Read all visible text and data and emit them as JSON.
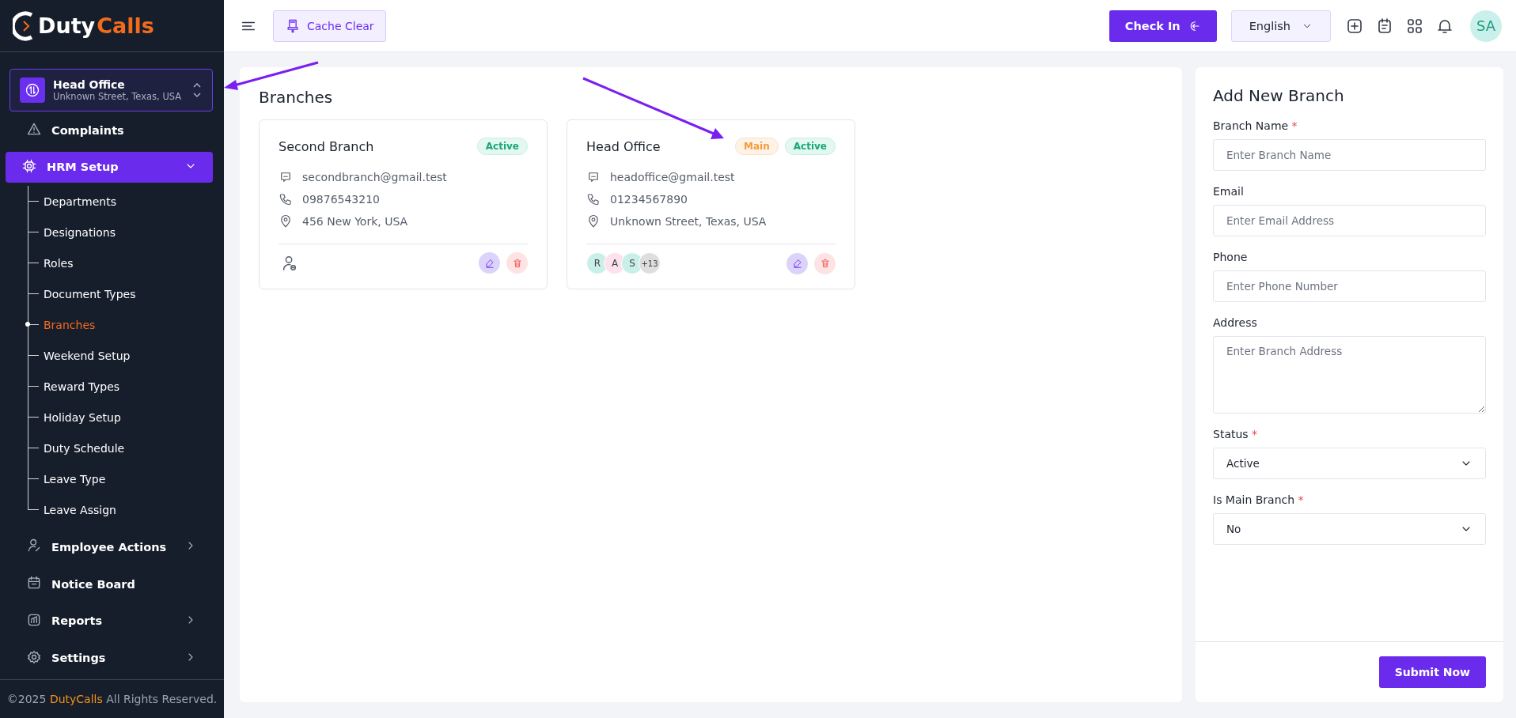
{
  "sidebar": {
    "logo": {
      "part_1": "Duty",
      "part_2": "Calls"
    },
    "branch_selector": {
      "name": "Head Office",
      "address": "Unknown Street, Texas, USA"
    },
    "menu": [
      {
        "label": "Complaints",
        "submenu": false,
        "expanded": false,
        "selected": false
      },
      {
        "label": "HRM Setup",
        "submenu": true,
        "expanded": true,
        "selected": true,
        "children": [
          {
            "label": "Departments",
            "selected": false
          },
          {
            "label": "Designations",
            "selected": false
          },
          {
            "label": "Roles",
            "selected": false
          },
          {
            "label": "Document Types",
            "selected": false
          },
          {
            "label": "Branches",
            "selected": true
          },
          {
            "label": "Weekend Setup",
            "selected": false
          },
          {
            "label": "Reward Types",
            "selected": false
          },
          {
            "label": "Holiday Setup",
            "selected": false
          },
          {
            "label": "Duty Schedule",
            "selected": false
          },
          {
            "label": "Leave Type",
            "selected": false
          },
          {
            "label": "Leave Assign",
            "selected": false
          }
        ]
      },
      {
        "label": "Employee Actions",
        "submenu": true,
        "expanded": false,
        "selected": false
      },
      {
        "label": "Notice Board",
        "submenu": false,
        "expanded": false,
        "selected": false
      },
      {
        "label": "Reports",
        "submenu": true,
        "expanded": false,
        "selected": false
      },
      {
        "label": "Settings",
        "submenu": true,
        "expanded": false,
        "selected": false
      }
    ],
    "footer": {
      "year": "©2025",
      "brand": "DutyCalls",
      "rights": "All Rights Reserved."
    }
  },
  "header": {
    "cache_button": "Cache Clear",
    "check_in_button": "Check In",
    "language": "English",
    "avatar": "SA"
  },
  "branches": {
    "title": "Branches",
    "cards": [
      {
        "name": "Second Branch",
        "badges": [
          {
            "label": "Active",
            "kind": "active"
          }
        ],
        "email": "secondbranch@gmail.test",
        "phone": "09876543210",
        "address": "456 New York, USA"
      },
      {
        "name": "Head Office",
        "badges": [
          {
            "label": "Main",
            "kind": "main"
          },
          {
            "label": "Active",
            "kind": "active"
          }
        ],
        "email": "headoffice@gmail.test",
        "phone": "01234567890",
        "address": "Unknown Street, Texas, USA",
        "avatars": [
          {
            "initials": "R",
            "color": "#c8efe8"
          },
          {
            "initials": "A",
            "color": "#fde1ec"
          },
          {
            "initials": "S",
            "color": "#c8efe8"
          }
        ],
        "more": "+13"
      }
    ]
  },
  "form": {
    "title": "Add New Branch",
    "fields": [
      {
        "label": "Branch Name",
        "required_mark": "*",
        "kind": "input",
        "placeholder": "Enter Branch Name"
      },
      {
        "label": "Email",
        "kind": "input",
        "placeholder": "Enter Email Address"
      },
      {
        "label": "Phone",
        "kind": "input",
        "placeholder": "Enter Phone Number"
      },
      {
        "label": "Address",
        "kind": "textarea",
        "placeholder": "Enter Branch Address"
      },
      {
        "label": "Status",
        "required_mark": "*",
        "kind": "select",
        "value": "Active"
      },
      {
        "label": "Is Main Branch",
        "required_mark": "*",
        "kind": "select",
        "value": "No"
      }
    ],
    "submit_button": "Submit Now"
  }
}
